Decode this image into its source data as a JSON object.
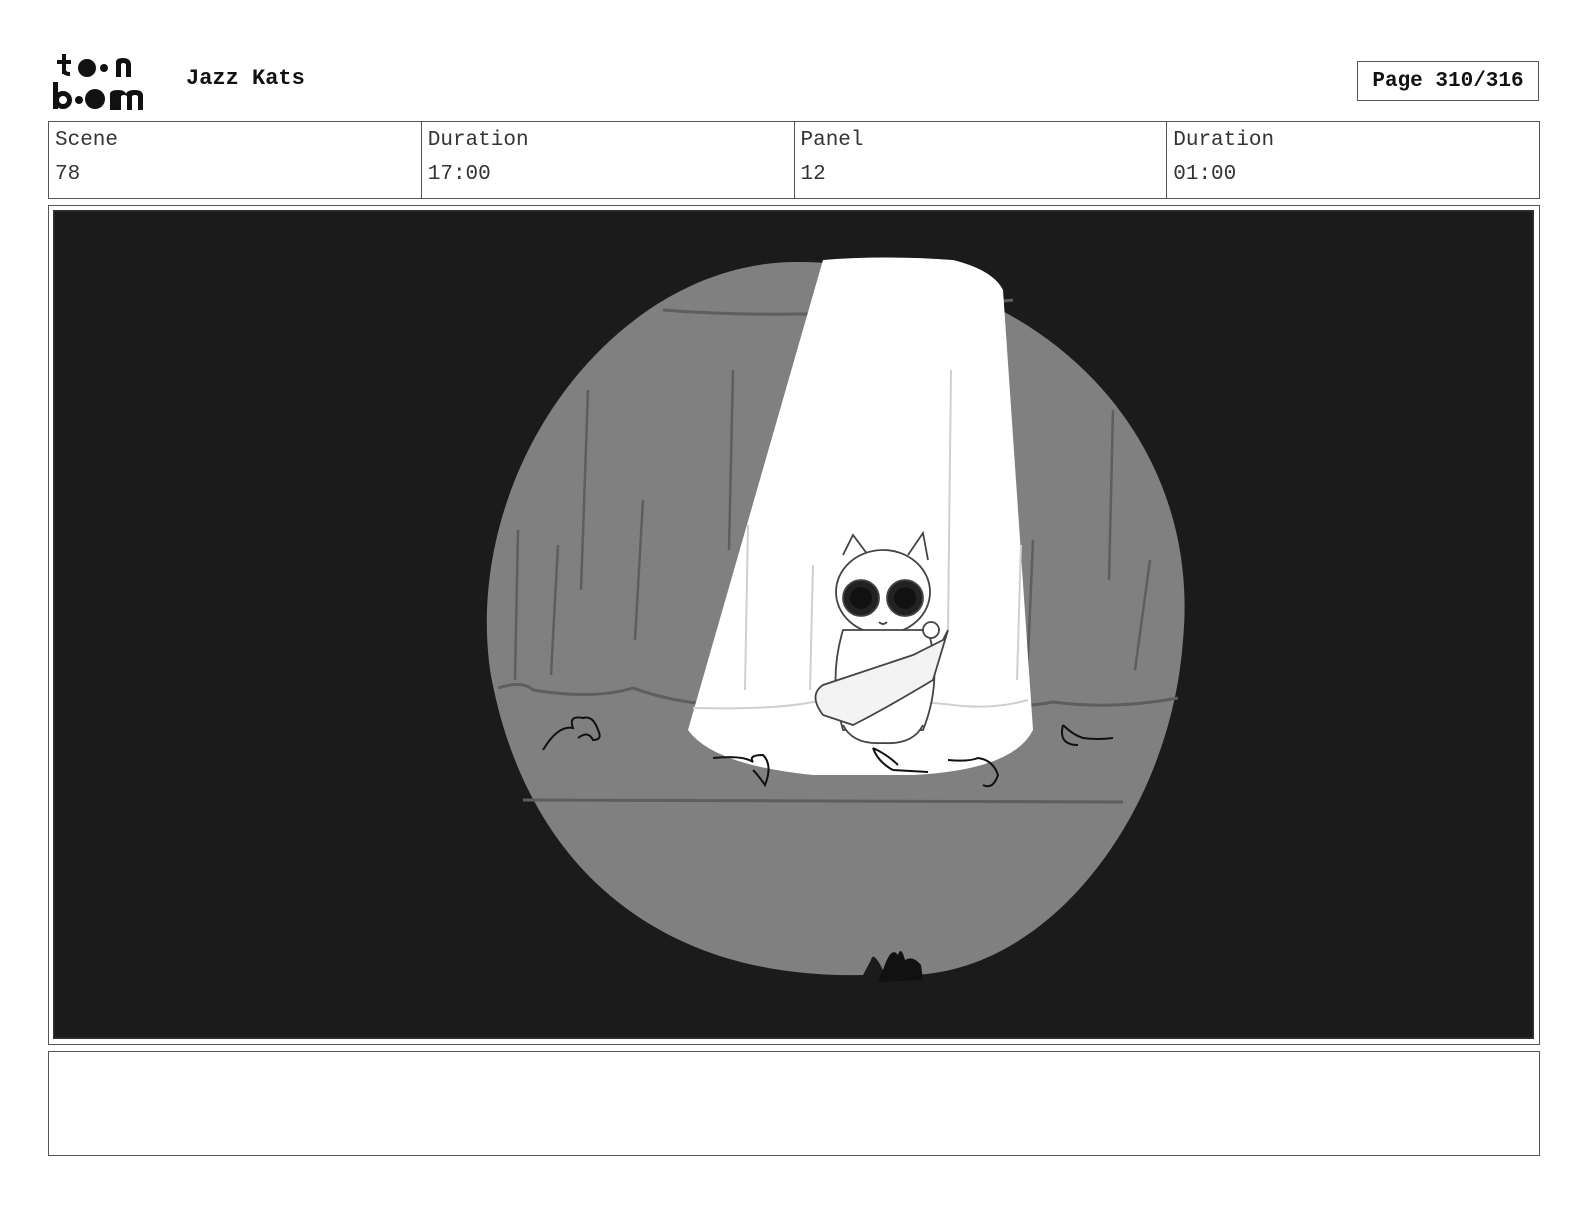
{
  "header": {
    "logo": "toon-boom-logo",
    "project_title": "Jazz Kats",
    "page_label": "Page 310/316"
  },
  "info": {
    "scene_label": "Scene",
    "scene_value": "78",
    "scene_duration_label": "Duration",
    "scene_duration_value": "17:00",
    "panel_label": "Panel",
    "panel_value": "12",
    "panel_duration_label": "Duration",
    "panel_duration_value": "01:00"
  },
  "panel": {
    "colors": {
      "background": "#1b1b1b",
      "spotlight_halo": "#808080",
      "spotlight_beam": "#ffffff"
    }
  },
  "notes": {
    "text": ""
  }
}
